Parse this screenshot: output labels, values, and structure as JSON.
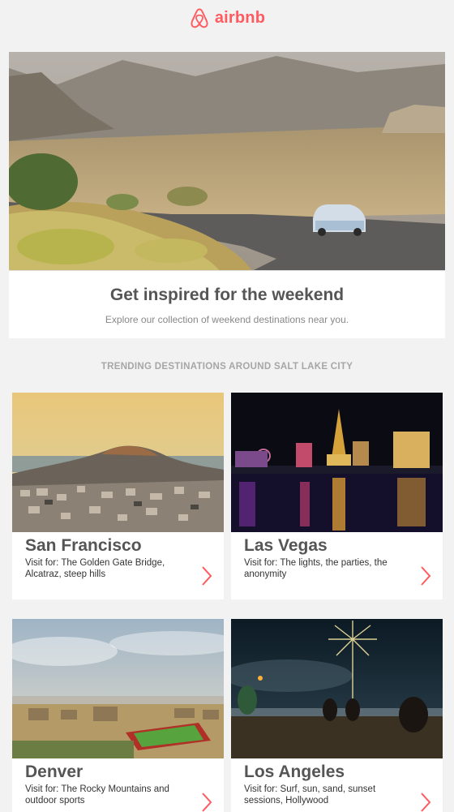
{
  "header": {
    "logo_text": "airbnb",
    "brand_color": "#ff5a5f"
  },
  "hero": {
    "title": "Get inspired for the weekend",
    "subtitle": "Explore our collection of weekend destinations near you."
  },
  "section": {
    "heading": "TRENDING DESTINATIONS AROUND SALT LAKE CITY"
  },
  "destinations": [
    {
      "name": "San Francisco",
      "desc": "Visit for: The Golden Gate Bridge, Alcatraz, steep hills"
    },
    {
      "name": "Las Vegas",
      "desc": "Visit for: The lights, the parties, the anonymity"
    },
    {
      "name": "Denver",
      "desc": "Visit for: The Rocky Mountains and outdoor sports"
    },
    {
      "name": "Los Angeles",
      "desc": "Visit for: Surf, sun, sand, sunset sessions, Hollywood"
    }
  ],
  "icons": {
    "arrow": "chevron-right-icon",
    "logo": "airbnb-logo-icon"
  }
}
